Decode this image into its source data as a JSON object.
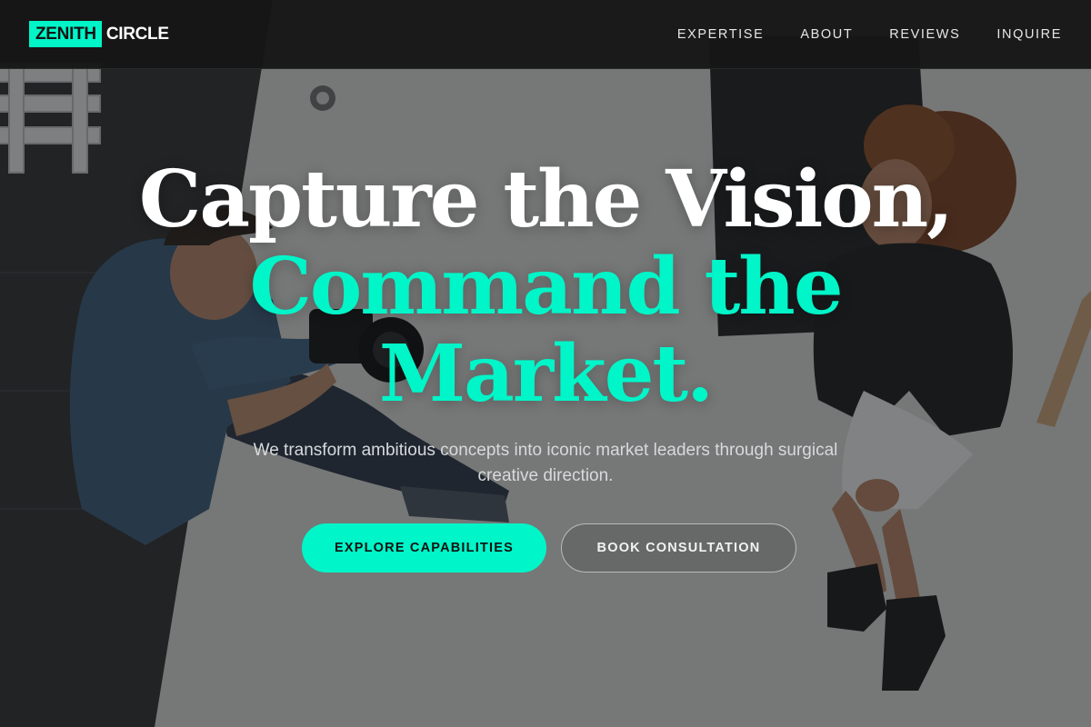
{
  "brand": {
    "logo_highlight": "ZENITH",
    "logo_text": "CIRCLE",
    "accent_color": "#00f5c8"
  },
  "nav": {
    "items": [
      {
        "label": "EXPERTISE"
      },
      {
        "label": "ABOUT"
      },
      {
        "label": "REVIEWS"
      },
      {
        "label": "INQUIRE"
      }
    ]
  },
  "hero": {
    "headline_line1": "Capture the Vision,",
    "headline_line2": "Command the",
    "headline_line3": "Market.",
    "subtitle": "We transform ambitious concepts into iconic market leaders through surgical creative direction.",
    "primary_cta": "EXPLORE CAPABILITIES",
    "secondary_cta": "BOOK CONSULTATION",
    "background_image": "photographer-and-model-photo"
  }
}
